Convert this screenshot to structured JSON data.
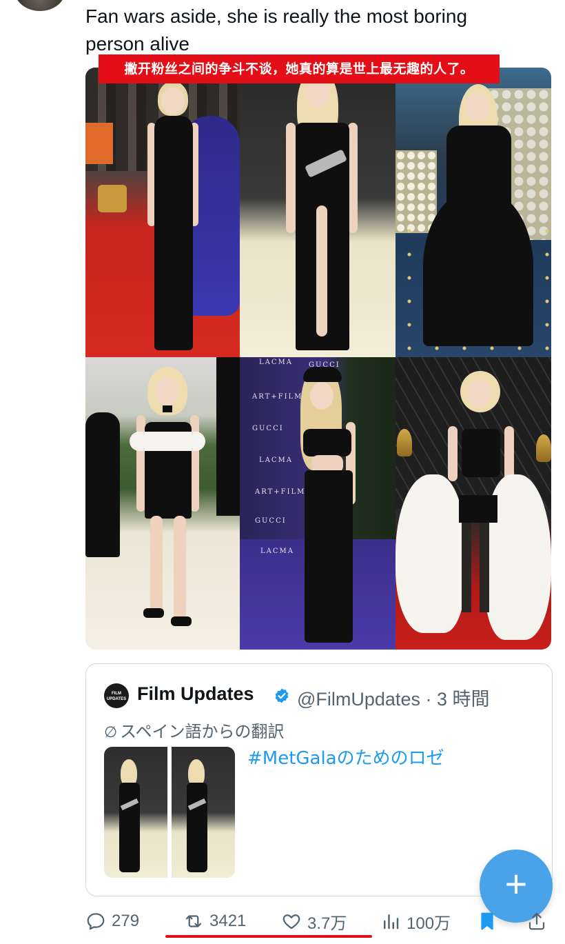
{
  "tweet": {
    "text_line1": "Fan wars aside, she is really the most boring",
    "text_line2": "person alive",
    "translation_banner": "撇开粉丝之间的争斗不谈，她真的算是世上最无趣的人了。"
  },
  "photos": {
    "p5_logos": [
      "LACMA",
      "GUCCI",
      "ART+FILM",
      "GUCCI",
      "LACMA",
      "ART+FILM",
      "GUCCI",
      "LACMA"
    ]
  },
  "quoted_tweet": {
    "avatar_text": "FILM UPDATES",
    "name": "Film Updates",
    "handle_time": "@FilmUpdates · 3 時間",
    "translation_note": "スペイン語からの翻訳",
    "hashtag_text": "#MetGalaのためのロゼ"
  },
  "actions": {
    "replies": "279",
    "reposts": "3421",
    "likes": "3.7万",
    "views": "100万"
  },
  "fab": {
    "label": "+"
  },
  "colors": {
    "accent_blue": "#1d9bf0",
    "banner_red": "#e40f16",
    "fab_blue": "#4aa3e8",
    "muted_text": "#536471"
  }
}
